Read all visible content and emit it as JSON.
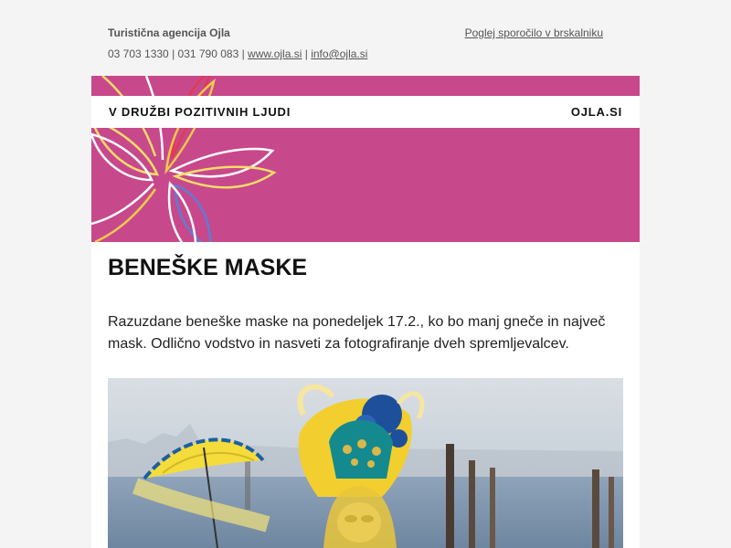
{
  "header": {
    "organization": "Turistična agencija Ojla",
    "phones": "03 703 1330 | 031 790 083 | ",
    "website_link": "www.ojla.si",
    "separator": " | ",
    "email_link": "info@ojla.si",
    "view_in_browser": "Poglej sporočilo v brskalniku"
  },
  "hero": {
    "tagline": "V DRUŽBI POZITIVNIH LJUDI",
    "brand": "OJLA.SI",
    "background_color": "#c8488c"
  },
  "article": {
    "title": "BENEŠKE MASKE",
    "body": "Razuzdane beneške maske na ponedeljek 17.2., ko bo manj gneče in največ mask. Odlično vodstvo in nasveti za fotografiranje dveh spremljevalcev."
  }
}
